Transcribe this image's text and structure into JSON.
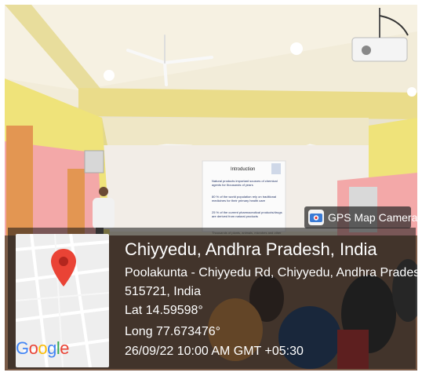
{
  "gps_app": {
    "name": "GPS Map Camera",
    "icon": "gps-camera-icon"
  },
  "location": {
    "place": "Chiyyedu, Andhra Pradesh, India",
    "road": "Poolakunta - Chiyyedu Rd, Chiyyedu, Andhra Pradesh",
    "postal": "515721, India",
    "latitude": "Lat 14.59598°",
    "longitude": "Long 77.673476°",
    "datetime": "26/09/22 10:00 AM GMT +05:30"
  },
  "map": {
    "brand": [
      "G",
      "o",
      "o",
      "g",
      "l",
      "e"
    ],
    "pin_icon": "map-pin-icon"
  },
  "slide": {
    "title": "Introduction",
    "bullets": [
      "Natural products important sources of chemical agents for thousands of years",
      "80 % of the world population rely on traditional medicines for their primary health care",
      "25 % of the current pharmaceutical products/drugs are derived from natural products"
    ],
    "footer": "Thousands of plants, animals, microbes and other"
  },
  "colors": {
    "google_blue": "#4285F4",
    "google_red": "#EA4335",
    "google_yellow": "#FBBC05",
    "google_green": "#34A853",
    "pin_red": "#EA4335"
  }
}
